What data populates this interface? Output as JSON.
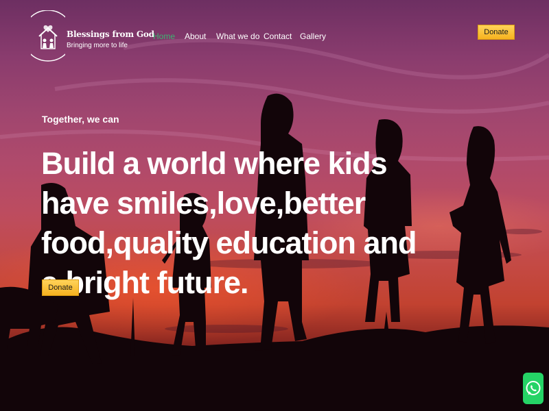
{
  "brand": {
    "name": "Blessings from God",
    "tagline": "Bringing more to life"
  },
  "nav": {
    "items": [
      {
        "label": "Home",
        "active": true
      },
      {
        "label": "About",
        "active": false
      },
      {
        "label": "What we do",
        "active": false
      },
      {
        "label": "Contact",
        "active": false
      },
      {
        "label": "Gallery",
        "active": false
      }
    ],
    "active_color": "#3cb371"
  },
  "header": {
    "donate_label": "Donate"
  },
  "hero": {
    "eyebrow": "Together, we can",
    "headline": "Build a world where kids have smiles,love,better food,quality education and a bright future.",
    "donate_label": "Donate"
  },
  "colors": {
    "accent": "#f6b21f",
    "text": "#ffffff",
    "whatsapp": "#25d366"
  },
  "icons": {
    "logo": "house-family-icon",
    "floating": "whatsapp-icon"
  }
}
